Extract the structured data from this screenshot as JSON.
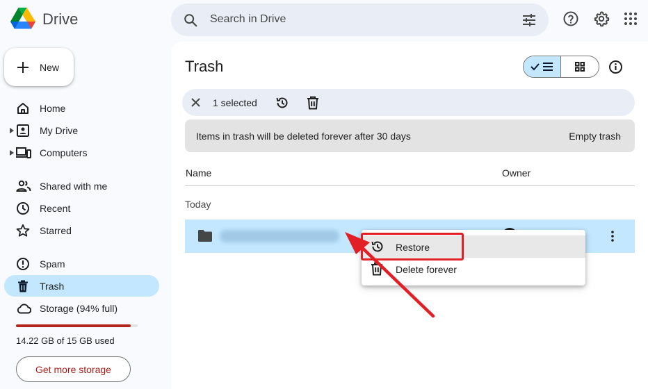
{
  "app": {
    "name": "Drive"
  },
  "search": {
    "placeholder": "Search in Drive"
  },
  "sidebar": {
    "new_label": "New",
    "items": [
      {
        "label": "Home",
        "icon": "home-icon"
      },
      {
        "label": "My Drive",
        "icon": "my-drive-icon",
        "expandable": true
      },
      {
        "label": "Computers",
        "icon": "computers-icon",
        "expandable": true
      },
      {
        "label": "Shared with me",
        "icon": "shared-icon"
      },
      {
        "label": "Recent",
        "icon": "clock-icon"
      },
      {
        "label": "Starred",
        "icon": "star-icon"
      },
      {
        "label": "Spam",
        "icon": "spam-icon"
      },
      {
        "label": "Trash",
        "icon": "trash-icon",
        "active": true
      },
      {
        "label": "Storage (94% full)",
        "icon": "cloud-icon"
      }
    ],
    "storage": {
      "used_fraction": 0.94,
      "text": "14.22 GB of 15 GB used",
      "button_label": "Get more storage"
    }
  },
  "main": {
    "title": "Trash",
    "selection": {
      "count_label": "1 selected"
    },
    "notice": {
      "text": "Items in trash will be deleted forever after 30 days",
      "action_label": "Empty trash"
    },
    "columns": {
      "name": "Name",
      "owner": "Owner"
    },
    "group_label": "Today"
  },
  "context_menu": {
    "items": [
      {
        "label": "Restore",
        "icon": "restore-icon",
        "highlighted": true
      },
      {
        "label": "Delete forever",
        "icon": "delete-forever-icon"
      }
    ]
  },
  "colors": {
    "accent": "#c2e7ff",
    "annotation": "#e21f26",
    "storage_warning": "#b3261e"
  }
}
